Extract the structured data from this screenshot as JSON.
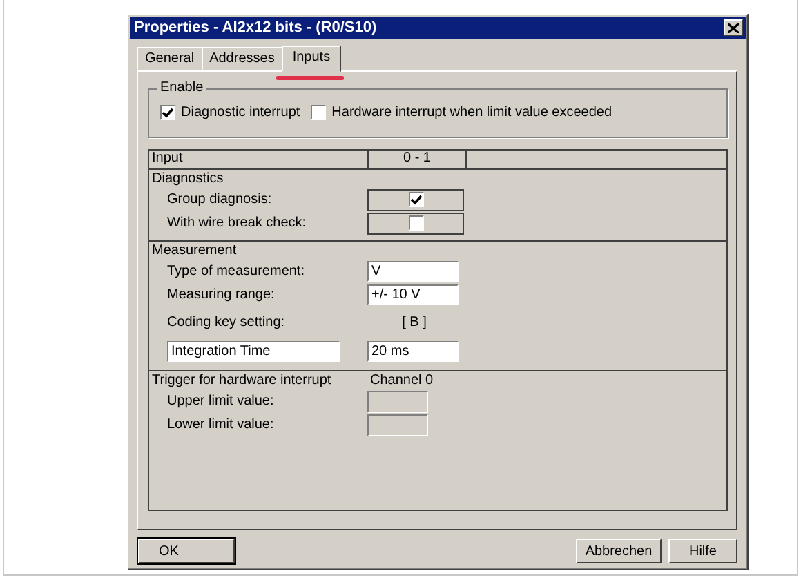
{
  "window": {
    "title": "Properties - AI2x12 bits - (R0/S10)"
  },
  "tabs": [
    {
      "label": "General",
      "selected": false
    },
    {
      "label": "Addresses",
      "selected": false
    },
    {
      "label": "Inputs",
      "selected": true,
      "highlighted": true
    }
  ],
  "enable": {
    "title": "Enable",
    "options": [
      {
        "label": "Diagnostic interrupt",
        "checked": true
      },
      {
        "label": "Hardware interrupt when limit value exceeded",
        "checked": false
      }
    ]
  },
  "table": {
    "columns": [
      "Input",
      "0 - 1"
    ],
    "sections": [
      {
        "title": "Diagnostics",
        "rows": [
          {
            "kind": "checkbox",
            "label": "Group diagnosis:",
            "checked": true
          },
          {
            "kind": "checkbox",
            "label": "With wire break check:",
            "checked": false
          }
        ]
      },
      {
        "title": "Measurement",
        "rows": [
          {
            "kind": "field",
            "label": "Type of measurement:",
            "value": "V",
            "disabled": false
          },
          {
            "kind": "field",
            "label": "Measuring range:",
            "value": "+/- 10 V",
            "disabled": false
          },
          {
            "kind": "text",
            "label": "Coding key setting:",
            "value": "[ B ]"
          },
          {
            "kind": "fieldpair",
            "label": "Integration Time",
            "value": "20 ms"
          }
        ]
      },
      {
        "title": "Trigger for hardware interrupt",
        "column_value": "Channel 0",
        "rows": [
          {
            "kind": "field",
            "label": "Upper limit value:",
            "disabled": true
          },
          {
            "kind": "field",
            "label": "Lower limit value:",
            "disabled": true
          }
        ]
      }
    ]
  },
  "buttons": [
    {
      "label": "OK",
      "default": true
    },
    {
      "label": "Abbrechen",
      "default": false
    },
    {
      "label": "Hilfe",
      "default": false
    }
  ]
}
